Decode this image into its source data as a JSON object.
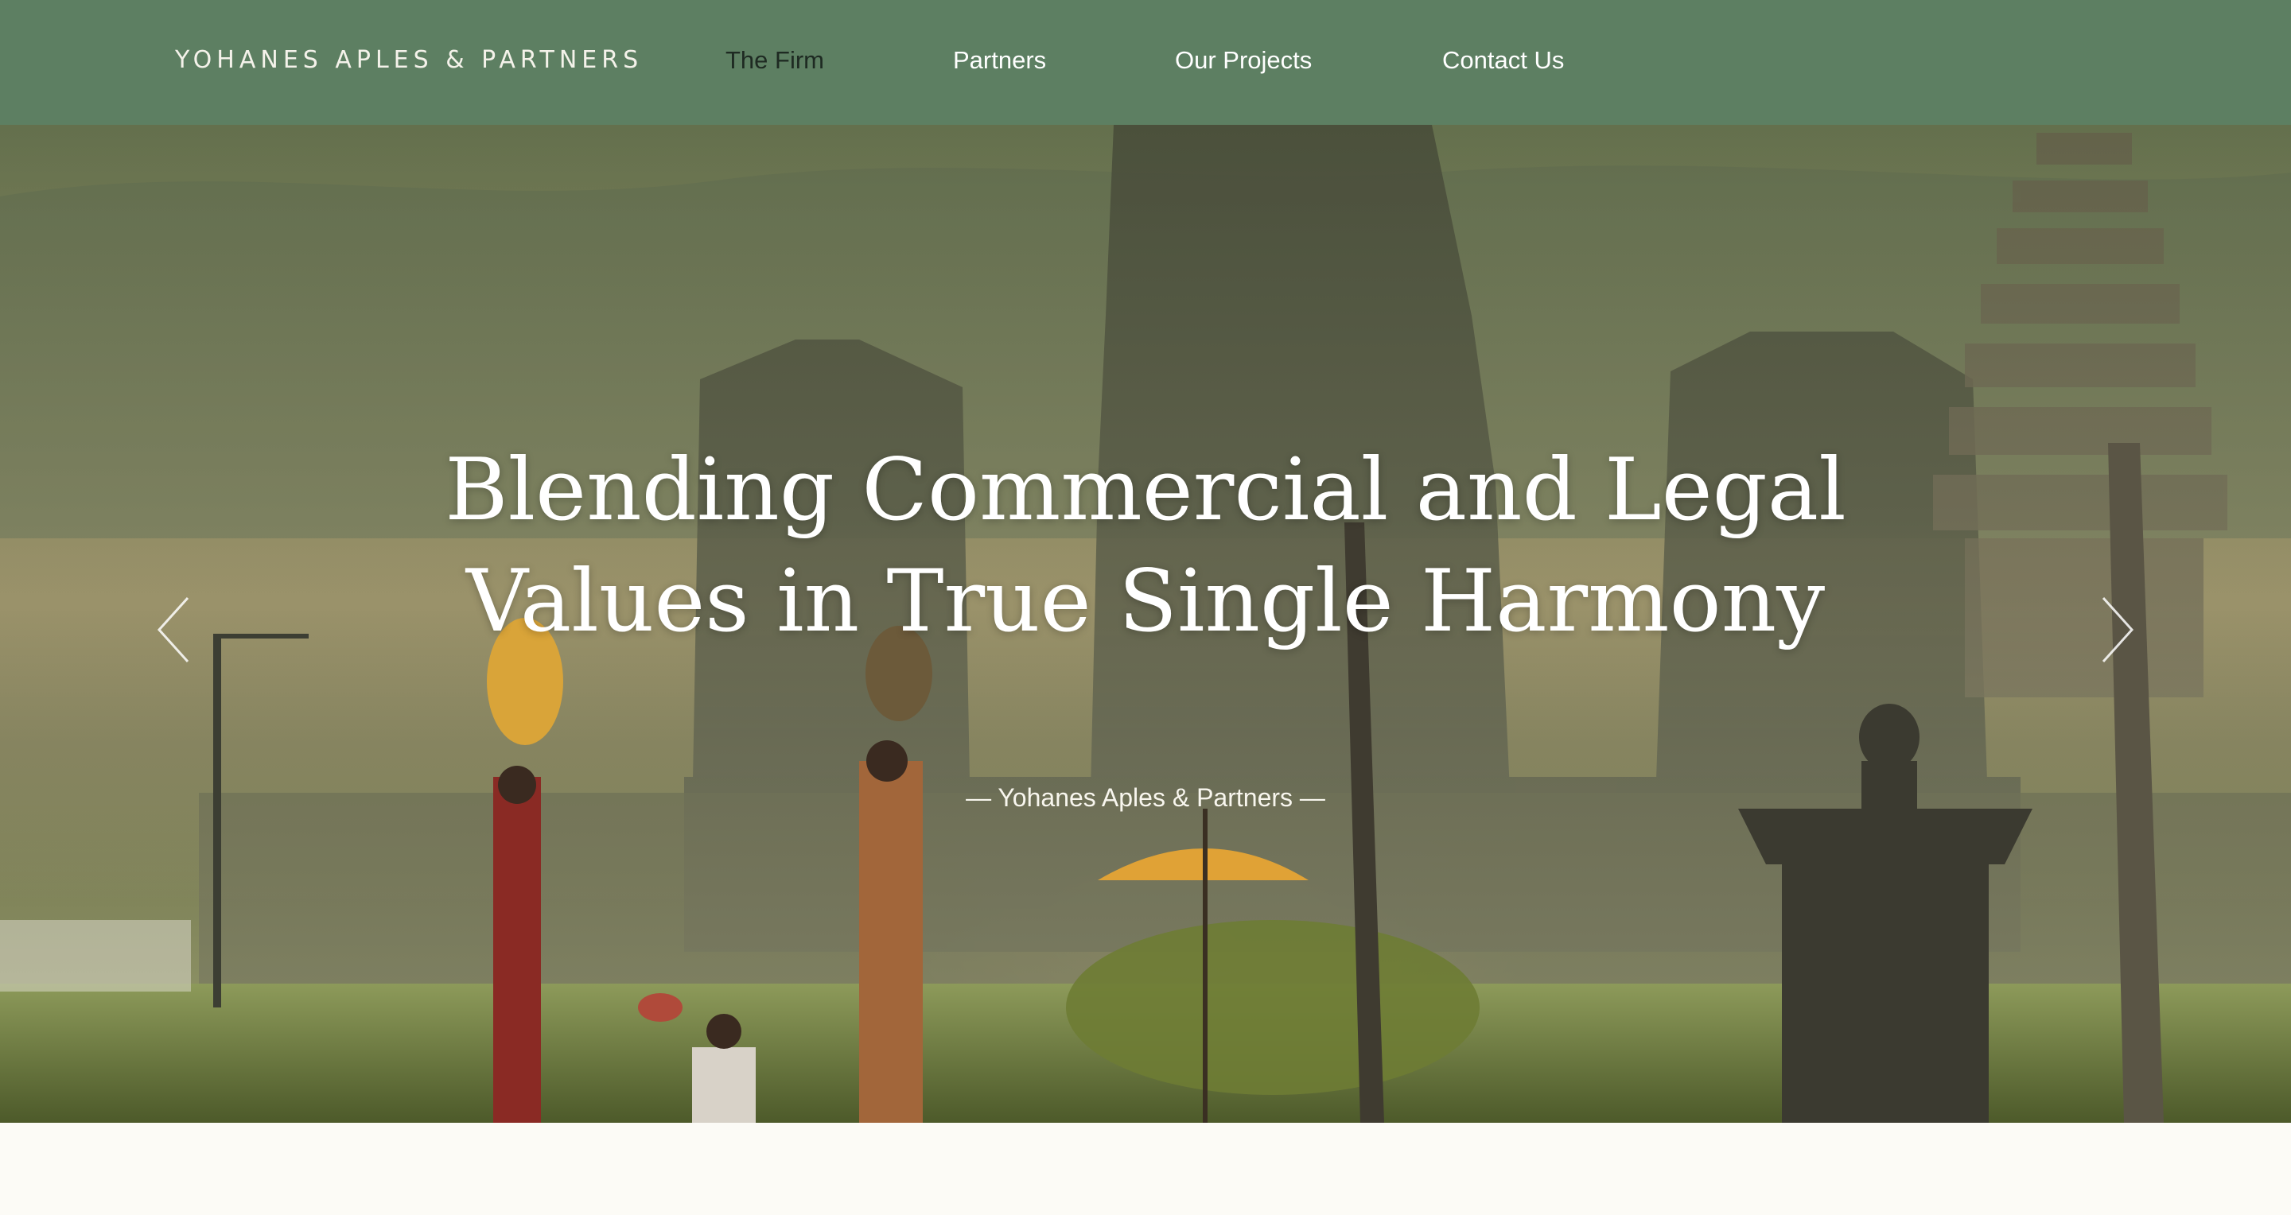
{
  "header": {
    "brand": "YOHANES APLES & PARTNERS",
    "nav": [
      {
        "label": "The Firm",
        "active": true
      },
      {
        "label": "Partners",
        "active": false
      },
      {
        "label": "Our Projects",
        "active": false
      },
      {
        "label": "Contact Us",
        "active": false
      }
    ]
  },
  "hero": {
    "title_line1": "Blending Commercial and Legal",
    "title_line2": "Values in True Single Harmony",
    "subtitle": "—  Yohanes Aples & Partners —",
    "prev_icon": "chevron-left-icon",
    "next_icon": "chevron-right-icon",
    "badge_icon": "play-circle-icon"
  },
  "colors": {
    "header_bg": "#5d7f62",
    "page_bg": "#fcfbf6",
    "accent": "#5d7f62"
  }
}
